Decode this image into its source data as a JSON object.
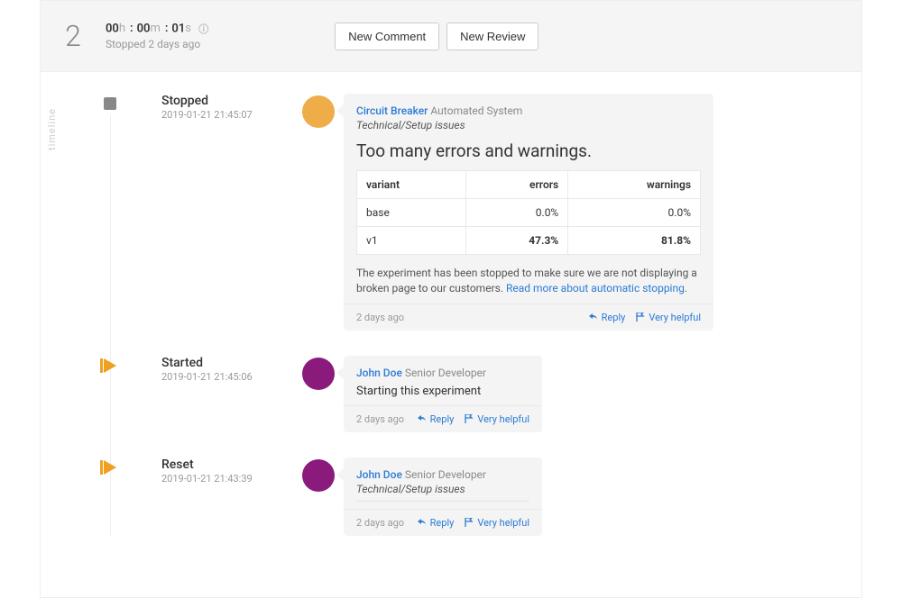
{
  "iteration": "2",
  "timer": {
    "h": "00",
    "m": "00",
    "s": "01",
    "sub": "Stopped 2 days ago"
  },
  "actions": {
    "new_comment": "New Comment",
    "new_review": "New Review"
  },
  "timeline_label": "timeline",
  "events": [
    {
      "marker": "stop",
      "title": "Stopped",
      "ts": "2019-01-21 21:45:07",
      "avatar": "orange",
      "card": {
        "width": "wide",
        "author": "Circuit Breaker",
        "role": "Automated System",
        "tag": "Technical/Setup issues",
        "headline": "Too many errors and warnings.",
        "table": {
          "cols": [
            "variant",
            "errors",
            "warnings"
          ],
          "rows": [
            {
              "cells": [
                "base",
                "0.0%",
                "0.0%"
              ],
              "emph": false
            },
            {
              "cells": [
                "v1",
                "47.3%",
                "81.8%"
              ],
              "emph": true
            }
          ]
        },
        "explain_pre": "The experiment has been stopped to make sure we are not displaying a broken page to our customers. ",
        "explain_link": "Read more about automatic stopping",
        "explain_post": ".",
        "footer_ts": "2 days ago"
      }
    },
    {
      "marker": "play",
      "title": "Started",
      "ts": "2019-01-21 21:45:06",
      "avatar": "purple",
      "card": {
        "width": "narrow",
        "author": "John Doe",
        "role": "Senior Developer",
        "text": "Starting this experiment",
        "footer_ts": "2 days ago"
      }
    },
    {
      "marker": "play",
      "title": "Reset",
      "ts": "2019-01-21 21:43:39",
      "avatar": "purple",
      "card": {
        "width": "narrow",
        "author": "John Doe",
        "role": "Senior Developer",
        "tag": "Technical/Setup issues",
        "footer_ts": "2 days ago"
      }
    }
  ],
  "footer_actions": {
    "reply": "Reply",
    "helpful": "Very helpful"
  }
}
